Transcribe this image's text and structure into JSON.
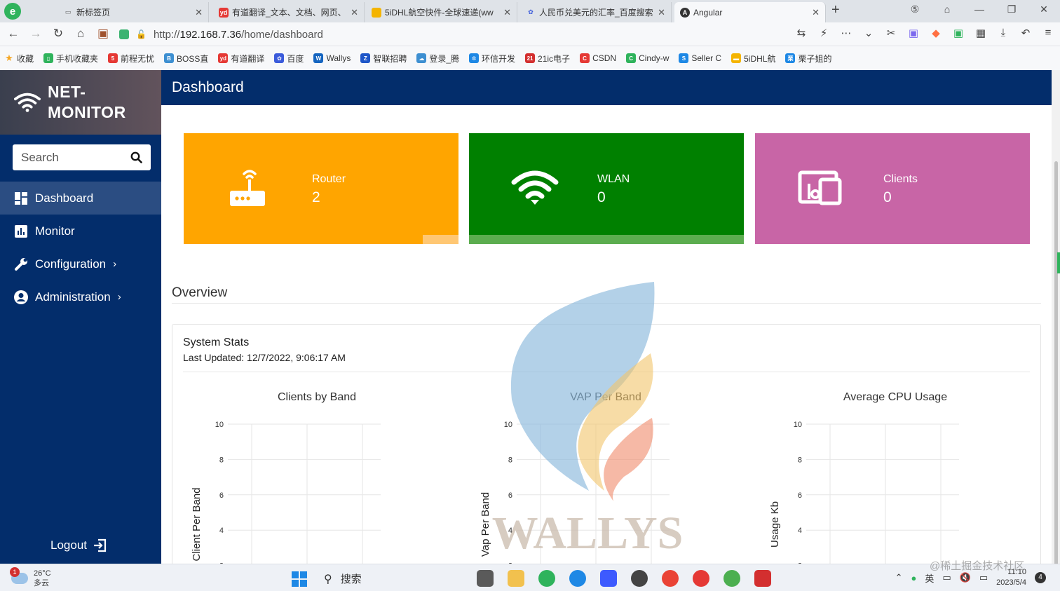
{
  "browser": {
    "tabs": [
      {
        "title": "新标签页",
        "color": "#8a8a8a",
        "glyph": "▭"
      },
      {
        "title": "有道翻译_文本、文档、网页、",
        "color": "#e53935",
        "glyph": "yd"
      },
      {
        "title": "5iDHL航空快件-全球速递(ww",
        "color": "#f4b400",
        "glyph": "▬"
      },
      {
        "title": "人民币兑美元的汇率_百度搜索",
        "color": "#3b5bdb",
        "glyph": "✿"
      },
      {
        "title": "Angular",
        "color": "#333333",
        "glyph": "A"
      }
    ],
    "url_prefix": "http://",
    "url_host": "192.168.7.36",
    "url_path": "/home/dashboard",
    "bookmarks": [
      {
        "label": "收藏",
        "color": "#f5a623",
        "glyph": "★"
      },
      {
        "label": "手机收藏夹",
        "color": "#2fb35c",
        "glyph": "▯"
      },
      {
        "label": "前程无忧",
        "color": "#e53935",
        "glyph": "5"
      },
      {
        "label": "BOSS直",
        "color": "#3d8fd1",
        "glyph": "B"
      },
      {
        "label": "有道翻译",
        "color": "#e53935",
        "glyph": "yd"
      },
      {
        "label": "百度",
        "color": "#3b5bdb",
        "glyph": "✿"
      },
      {
        "label": "Wallys ",
        "color": "#1565c0",
        "glyph": "W"
      },
      {
        "label": "智联招聘",
        "color": "#1e56c8",
        "glyph": "Z"
      },
      {
        "label": "登录_腾",
        "color": "#3d8fd1",
        "glyph": "☁"
      },
      {
        "label": "环信开发",
        "color": "#1e88e5",
        "glyph": "✲"
      },
      {
        "label": "21ic电子",
        "color": "#d32f2f",
        "glyph": "21"
      },
      {
        "label": "CSDN",
        "color": "#e53935",
        "glyph": "C"
      },
      {
        "label": "Cindy-w",
        "color": "#2fb35c",
        "glyph": "C"
      },
      {
        "label": "Seller C",
        "color": "#1e88e5",
        "glyph": "S"
      },
      {
        "label": "5iDHL航",
        "color": "#f4b400",
        "glyph": "▬"
      },
      {
        "label": "栗子姐的",
        "color": "#1e88e5",
        "glyph": "栗"
      }
    ]
  },
  "app": {
    "brand_line1": "NET-",
    "brand_line2": "MONITOR",
    "search_placeholder": "Search",
    "page_title": "Dashboard",
    "nav": [
      {
        "label": "Dashboard",
        "icon": "dashboard-icon",
        "active": true
      },
      {
        "label": "Monitor",
        "icon": "bar-chart-icon"
      },
      {
        "label": "Configuration",
        "icon": "wrench-icon",
        "chevron": true
      },
      {
        "label": "Administration",
        "icon": "user-circle-icon",
        "chevron": true
      }
    ],
    "logout_label": "Logout"
  },
  "cards": [
    {
      "label": "Router",
      "value": "2",
      "color": "#ffa500",
      "foot_color": "#ffc773",
      "icon": "router-icon"
    },
    {
      "label": "WLAN",
      "value": "0",
      "color": "#008000",
      "foot_color": "#5cad4f",
      "icon": "wifi-icon"
    },
    {
      "label": "Clients",
      "value": "0",
      "color": "#c865a6",
      "foot_color": "#c865a6",
      "icon": "devices-icon"
    }
  ],
  "overview": {
    "title": "Overview",
    "stats_title": "System Stats",
    "last_updated": "Last Updated: 12/7/2022, 9:06:17 AM"
  },
  "chart_data": [
    {
      "type": "bar",
      "title": "Clients by Band",
      "ylabel": "Client Per Band",
      "ylim": [
        0,
        10
      ],
      "yticks": [
        2,
        4,
        6,
        8,
        10
      ],
      "grid": true,
      "categories": [],
      "values": []
    },
    {
      "type": "bar",
      "title": "VAP Per Band",
      "ylabel": "Vap Per Band",
      "ylim": [
        0,
        10
      ],
      "yticks": [
        2,
        4,
        6,
        8,
        10
      ],
      "grid": true,
      "categories": [],
      "values": []
    },
    {
      "type": "bar",
      "title": "Average CPU Usage",
      "ylabel": "Usage Kb",
      "ylim": [
        0,
        10
      ],
      "yticks": [
        2,
        4,
        6,
        8,
        10
      ],
      "grid": true,
      "series": [
        {
          "color": "#b03060"
        },
        {
          "color": "#7fa7e0"
        }
      ]
    }
  ],
  "watermark": {
    "text": "WALLYS"
  },
  "taskbar": {
    "weather_temp": "26°C",
    "weather_desc": "多云",
    "weather_badge": "1",
    "search_label": "搜索",
    "ime": "英",
    "time": "11:10",
    "date": "2023/5/4",
    "notifications": "4",
    "attribution": "@稀土掘金技术社区"
  }
}
